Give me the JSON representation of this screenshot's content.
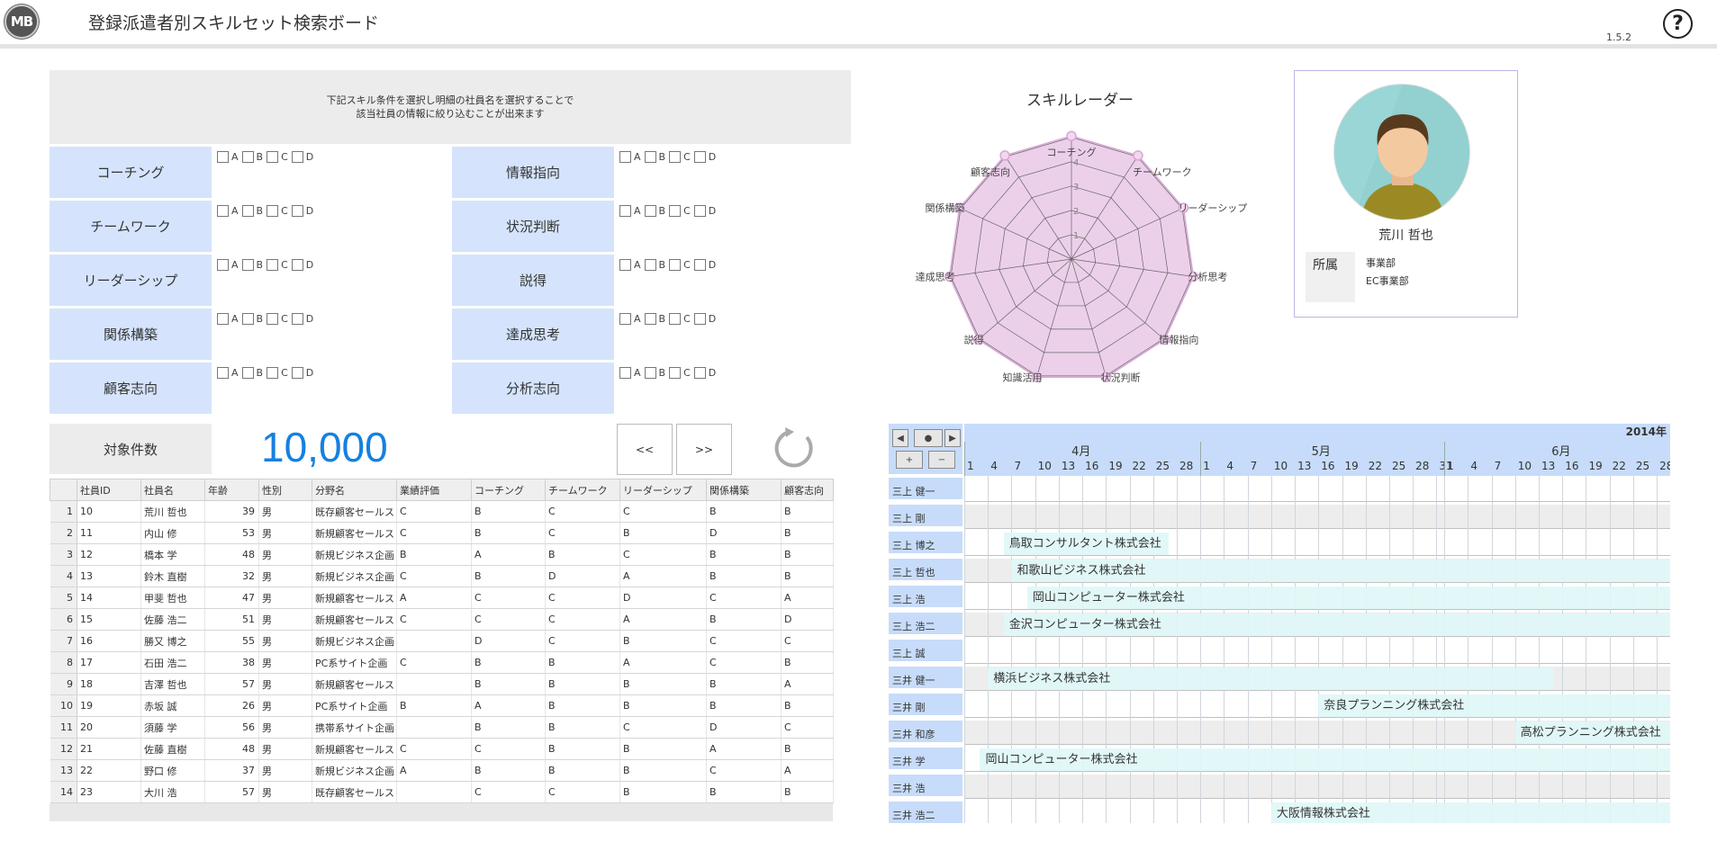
{
  "header": {
    "logo": "MB",
    "title": "登録派遣者別スキルセット検索ボード",
    "version": "1.5.2",
    "help": "?"
  },
  "filter": {
    "note_line1": "下記スキル条件を選択し明細の社員名を選択することで",
    "note_line2": "該当社員の情報に絞り込むことが出来ます",
    "options": [
      "A",
      "B",
      "C",
      "D"
    ],
    "left_skills": [
      "コーチング",
      "チームワーク",
      "リーダーシップ",
      "関係構築",
      "顧客志向"
    ],
    "right_skills": [
      "情報指向",
      "状況判断",
      "説得",
      "達成思考",
      "分析志向"
    ]
  },
  "count": {
    "label": "対象件数",
    "value": "10,000",
    "prev": "<<",
    "next": ">>"
  },
  "table": {
    "headers": [
      "",
      "社員ID",
      "社員名",
      "年齢",
      "性別",
      "分野名",
      "業績評価",
      "コーチング",
      "チームワーク",
      "リーダーシップ",
      "関係構築",
      "顧客志向"
    ],
    "rows": [
      [
        "1",
        "10",
        "荒川 哲也",
        "39",
        "男",
        "既存顧客セールス",
        "C",
        "B",
        "C",
        "C",
        "B",
        "B"
      ],
      [
        "2",
        "11",
        "内山 修",
        "53",
        "男",
        "新規顧客セールス",
        "C",
        "B",
        "C",
        "B",
        "D",
        "B"
      ],
      [
        "3",
        "12",
        "橋本 学",
        "48",
        "男",
        "新規ビジネス企画",
        "B",
        "A",
        "B",
        "C",
        "B",
        "B"
      ],
      [
        "4",
        "13",
        "鈴木 直樹",
        "32",
        "男",
        "新規ビジネス企画",
        "C",
        "B",
        "D",
        "A",
        "B",
        "B"
      ],
      [
        "5",
        "14",
        "甲斐 哲也",
        "47",
        "男",
        "新規顧客セールス",
        "A",
        "C",
        "C",
        "D",
        "C",
        "A"
      ],
      [
        "6",
        "15",
        "佐藤 浩二",
        "51",
        "男",
        "新規顧客セールス",
        "C",
        "C",
        "C",
        "A",
        "B",
        "D"
      ],
      [
        "7",
        "16",
        "勝又 博之",
        "55",
        "男",
        "新規ビジネス企画",
        "",
        "D",
        "C",
        "B",
        "C",
        "C"
      ],
      [
        "8",
        "17",
        "石田 浩二",
        "38",
        "男",
        "PC系サイト企画",
        "C",
        "B",
        "B",
        "A",
        "C",
        "B"
      ],
      [
        "9",
        "18",
        "吉澤 哲也",
        "57",
        "男",
        "新規顧客セールス",
        "",
        "B",
        "B",
        "B",
        "B",
        "A"
      ],
      [
        "10",
        "19",
        "赤坂 誠",
        "26",
        "男",
        "PC系サイト企画",
        "B",
        "A",
        "B",
        "B",
        "B",
        "B"
      ],
      [
        "11",
        "20",
        "須藤 学",
        "56",
        "男",
        "携帯系サイト企画",
        "",
        "B",
        "B",
        "C",
        "D",
        "C"
      ],
      [
        "12",
        "21",
        "佐藤 直樹",
        "48",
        "男",
        "新規顧客セールス",
        "C",
        "C",
        "B",
        "B",
        "A",
        "B"
      ],
      [
        "13",
        "22",
        "野口 修",
        "37",
        "男",
        "新規ビジネス企画",
        "A",
        "B",
        "B",
        "B",
        "C",
        "A"
      ],
      [
        "14",
        "23",
        "大川 浩",
        "57",
        "男",
        "既存顧客セールス",
        "",
        "C",
        "C",
        "B",
        "B",
        "B"
      ]
    ]
  },
  "radar": {
    "title": "スキルレーダー",
    "axes": [
      "コーチング",
      "チームワーク",
      "リーダーシップ",
      "分析思考",
      "情報指向",
      "状況判断",
      "知識活用",
      "説得",
      "達成思考",
      "関係構築",
      "顧客志向"
    ],
    "scale_labels": [
      "1",
      "2",
      "3",
      "4"
    ],
    "values": [
      4.5,
      4.5,
      4.5,
      4.5,
      4.5,
      4.5,
      4.5,
      4.5,
      4.5,
      4.5,
      4.5
    ],
    "max": 5
  },
  "profile": {
    "name": "荒川 哲也",
    "belong_label": "所属",
    "dept1": "事業部",
    "dept2": "EC事業部"
  },
  "gantt": {
    "year": "2014年",
    "months": [
      "4月",
      "5月",
      "6月"
    ],
    "days_april": [
      "1",
      "4",
      "7",
      "10",
      "13",
      "16",
      "19",
      "22",
      "25",
      "28"
    ],
    "days_may": [
      "1",
      "4",
      "7",
      "10",
      "13",
      "16",
      "19",
      "22",
      "25",
      "28",
      "31"
    ],
    "days_june": [
      "1",
      "4",
      "7",
      "10",
      "13",
      "16",
      "19",
      "22",
      "25",
      "28"
    ],
    "rows": [
      {
        "name": "三上 健一",
        "bar": ""
      },
      {
        "name": "三上 剛",
        "bar": ""
      },
      {
        "name": "三上 博之",
        "bar": "鳥取コンサルタント株式会社"
      },
      {
        "name": "三上 哲也",
        "bar": "和歌山ビジネス株式会社"
      },
      {
        "name": "三上 浩",
        "bar": "岡山コンピューター株式会社"
      },
      {
        "name": "三上 浩二",
        "bar": "金沢コンピューター株式会社"
      },
      {
        "name": "三上 誠",
        "bar": ""
      },
      {
        "name": "三井 健一",
        "bar": "横浜ビジネス株式会社"
      },
      {
        "name": "三井 剛",
        "bar": "奈良プランニング株式会社"
      },
      {
        "name": "三井 和彦",
        "bar": "高松プランニング株式会社"
      },
      {
        "name": "三井 学",
        "bar": "岡山コンピューター株式会社"
      },
      {
        "name": "三井 浩",
        "bar": ""
      },
      {
        "name": "三井 浩二",
        "bar": "大阪情報株式会社"
      }
    ]
  }
}
